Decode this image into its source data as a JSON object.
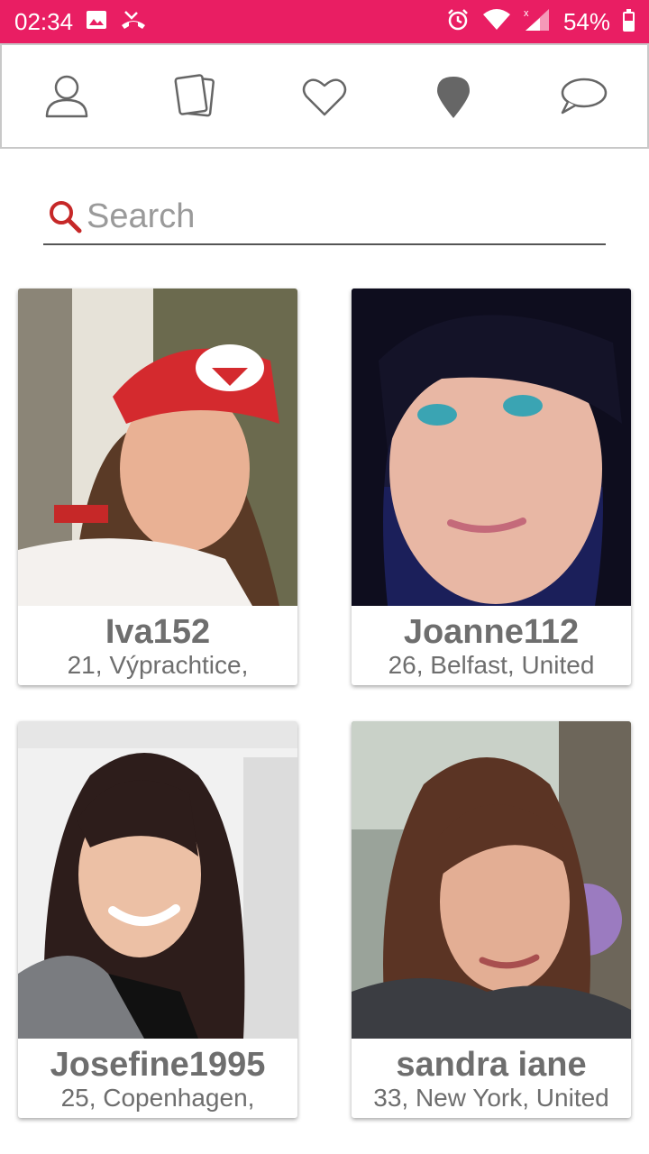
{
  "status_bar": {
    "time": "02:34",
    "battery_percent": "54%",
    "battery_level": 0.54,
    "left_icons": [
      "image-icon",
      "missed-call-icon"
    ],
    "right_icons": [
      "alarm-icon",
      "wifi-icon",
      "signal-icon",
      "battery-icon"
    ],
    "background": "#e91e63"
  },
  "nav": {
    "items": [
      {
        "name": "profile",
        "icon": "user-icon"
      },
      {
        "name": "cards",
        "icon": "cards-icon"
      },
      {
        "name": "likes",
        "icon": "heart-icon"
      },
      {
        "name": "nearby",
        "icon": "location-pin-icon",
        "active": true
      },
      {
        "name": "messages",
        "icon": "chat-bubble-icon"
      }
    ]
  },
  "search": {
    "placeholder": "Search",
    "value": "",
    "icon": "search-icon",
    "icon_color": "#c62828"
  },
  "profiles": [
    {
      "name": "Iva152",
      "meta": "21, Výprachtice,"
    },
    {
      "name": "Joanne112",
      "meta": "26, Belfast, United"
    },
    {
      "name": "Josefine1995",
      "meta": "25, Copenhagen,"
    },
    {
      "name": "sandra iane",
      "meta": "33, New York, United"
    }
  ]
}
